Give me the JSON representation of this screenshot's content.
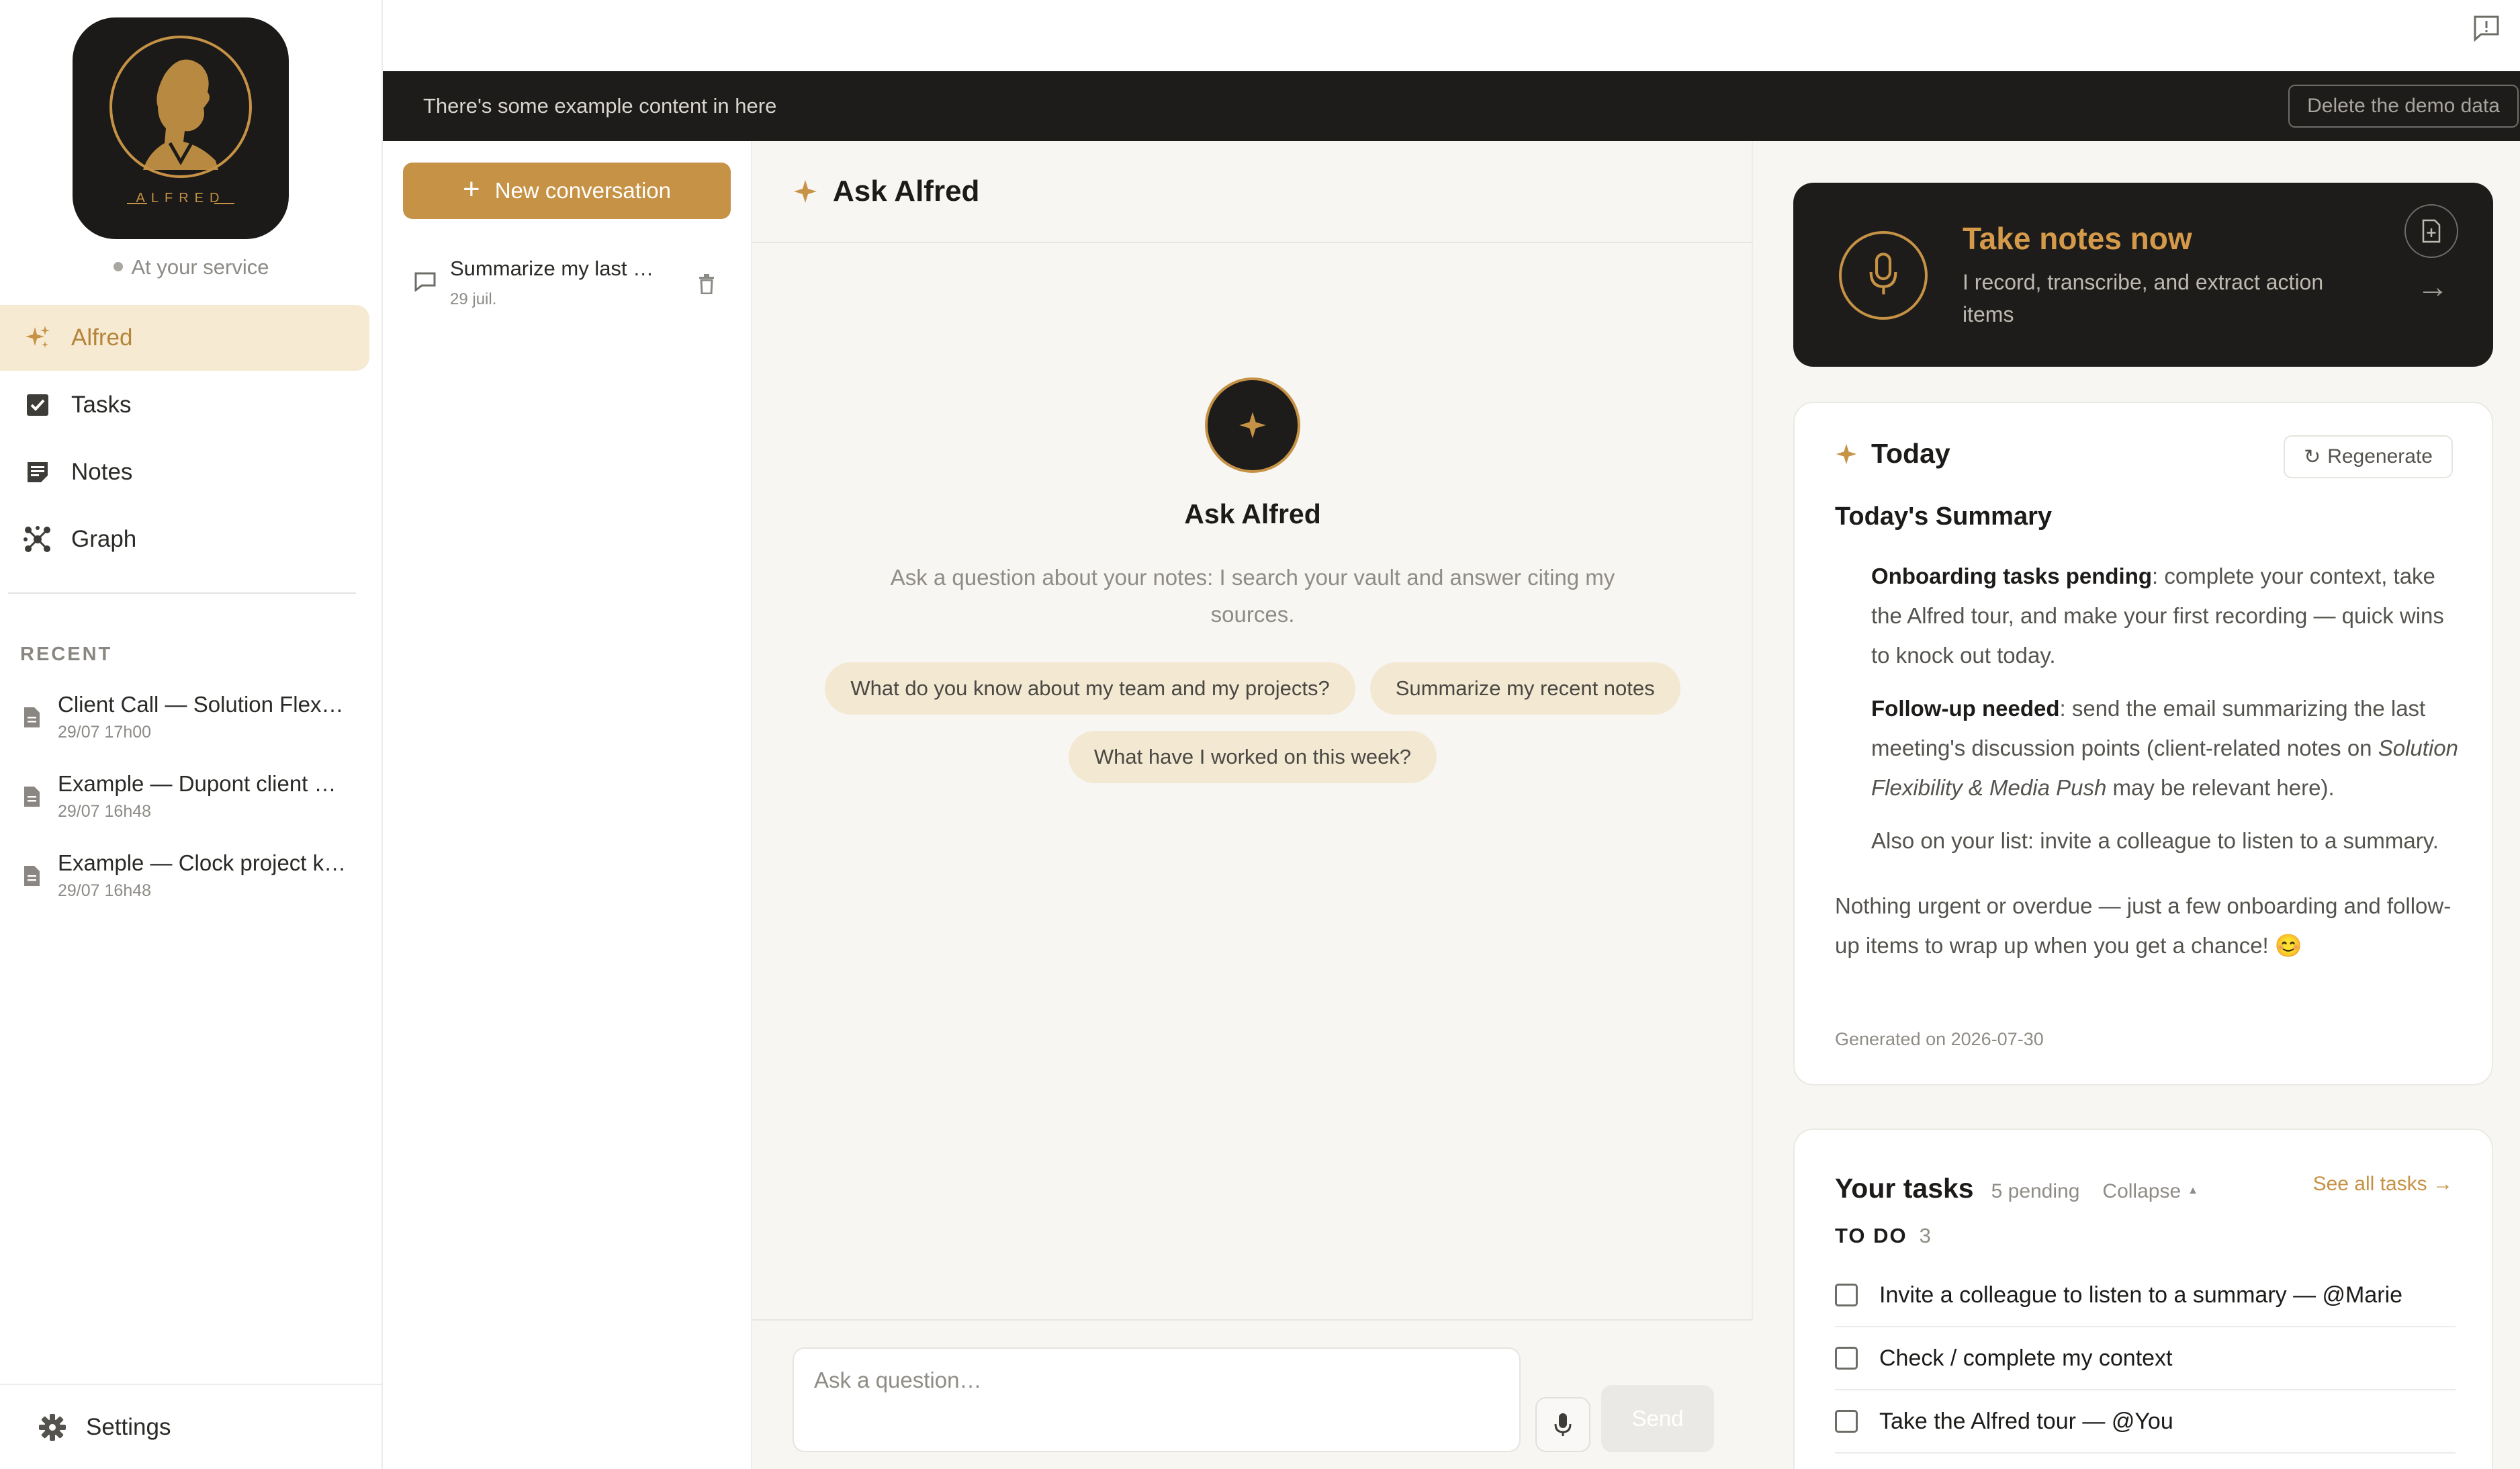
{
  "sidebar": {
    "logo_text": "ALFRED",
    "status": "At your service",
    "nav": [
      {
        "label": "Alfred",
        "icon": "sparkles-icon",
        "active": true
      },
      {
        "label": "Tasks",
        "icon": "checkbox-icon",
        "active": false
      },
      {
        "label": "Notes",
        "icon": "note-icon",
        "active": false
      },
      {
        "label": "Graph",
        "icon": "graph-icon",
        "active": false
      }
    ],
    "recent_title": "RECENT",
    "recent": [
      {
        "title": "Client Call — Solution Flexibility & Media Push",
        "date": "29/07 17h00"
      },
      {
        "title": "Example — Dupont client meeting",
        "date": "29/07 16h48"
      },
      {
        "title": "Example — Clock project kickoff",
        "date": "29/07 16h48"
      }
    ],
    "settings_label": "Settings"
  },
  "banner": {
    "text": "There's some example content in here",
    "button": "Delete the demo data"
  },
  "conversations": {
    "new_button": "New conversation",
    "items": [
      {
        "title": "Summarize my last meeting",
        "date": "29 juil."
      }
    ]
  },
  "chat": {
    "header_title": "Ask Alfred",
    "hero_title": "Ask Alfred",
    "hero_subtitle": "Ask a question about your notes: I search your vault and answer citing my sources.",
    "suggestions": [
      "What do you know about my team and my projects?",
      "Summarize my recent notes",
      "What have I worked on this week?"
    ],
    "input_placeholder": "Ask a question…",
    "send_label": "Send"
  },
  "notes_card": {
    "title": "Take notes now",
    "subtitle": "I record, transcribe, and extract action items",
    "arrow": "→"
  },
  "today": {
    "title": "Today",
    "regenerate": "Regenerate",
    "summary_title": "Today's Summary",
    "bullet1_bold": "Onboarding tasks pending",
    "bullet1_rest": ": complete your context, take the Alfred tour, and make your first recording — quick wins to knock out today.",
    "bullet2_bold": "Follow-up needed",
    "bullet2_rest": ": send the email summarizing the last meeting's discussion points (client-related notes on ",
    "bullet2_italic": "Solution Flexibility & Media Push",
    "bullet2_end": " may be relevant here).",
    "bullet3": "Also on your list: invite a colleague to listen to a summary.",
    "closing": "Nothing urgent or overdue — just a few onboarding and follow-up items to wrap up when you get a chance! 😊",
    "generated": "Generated on 2026-07-30"
  },
  "tasks": {
    "title": "Your tasks",
    "pending": "5 pending",
    "collapse": "Collapse",
    "see_all": "See all tasks →",
    "todo_label": "TO DO",
    "todo_count": "3",
    "items": [
      "Invite a colleague to listen to a summary — @Marie",
      "Check / complete my context",
      "Take the Alfred tour — @You"
    ]
  },
  "colors": {
    "accent": "#c69245",
    "dark": "#1d1c1a",
    "active_bg": "#f6ead3",
    "chip_bg": "#f3e8d2"
  }
}
